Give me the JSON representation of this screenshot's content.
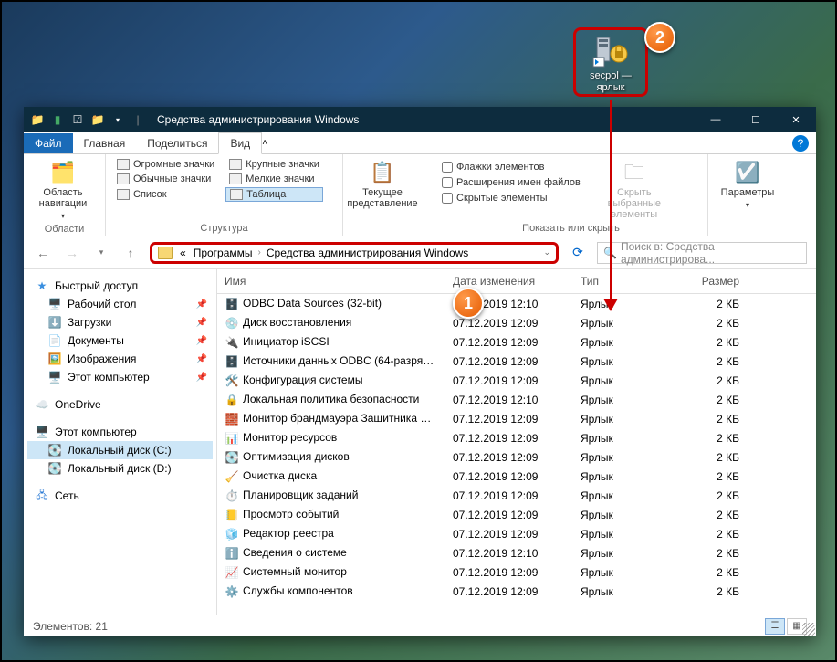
{
  "desktop": {
    "shortcut_label": "secpol — ярлык"
  },
  "callouts": {
    "one": "1",
    "two": "2"
  },
  "window": {
    "title": "Средства администрирования Windows",
    "tabs": {
      "file": "Файл",
      "home": "Главная",
      "share": "Поделиться",
      "view": "Вид"
    },
    "ribbon": {
      "nav_pane": "Область навигации",
      "group_areas": "Области",
      "layout": {
        "huge": "Огромные значки",
        "large": "Крупные значки",
        "normal": "Обычные значки",
        "small": "Мелкие значки",
        "list": "Список",
        "table": "Таблица"
      },
      "group_layout": "Структура",
      "current_view": "Текущее представление",
      "checks": {
        "checkboxes": "Флажки элементов",
        "ext": "Расширения имен файлов",
        "hidden": "Скрытые элементы"
      },
      "hide_selected": "Скрыть выбранные элементы",
      "group_showhide": "Показать или скрыть",
      "options": "Параметры"
    },
    "breadcrumb": {
      "prefix": "«",
      "p1": "Программы",
      "p2": "Средства администрирования Windows"
    },
    "search_placeholder": "Поиск в: Средства администрирова...",
    "columns": {
      "name": "Имя",
      "date": "Дата изменения",
      "type": "Тип",
      "size": "Размер"
    },
    "sidebar": {
      "quick": "Быстрый доступ",
      "desktop": "Рабочий стол",
      "downloads": "Загрузки",
      "documents": "Документы",
      "pictures": "Изображения",
      "thispc_q": "Этот компьютер",
      "onedrive": "OneDrive",
      "thispc": "Этот компьютер",
      "diskc": "Локальный диск (C:)",
      "diskd": "Локальный диск (D:)",
      "network": "Сеть"
    },
    "files": [
      {
        "name": "ODBC Data Sources (32-bit)",
        "date": "07.12.2019 12:10",
        "type": "Ярлык",
        "size": "2 КБ",
        "ico": "🗄️"
      },
      {
        "name": "Диск восстановления",
        "date": "07.12.2019 12:09",
        "type": "Ярлык",
        "size": "2 КБ",
        "ico": "💿"
      },
      {
        "name": "Инициатор iSCSI",
        "date": "07.12.2019 12:09",
        "type": "Ярлык",
        "size": "2 КБ",
        "ico": "🔌"
      },
      {
        "name": "Источники данных ODBC (64-разрядна...",
        "date": "07.12.2019 12:09",
        "type": "Ярлык",
        "size": "2 КБ",
        "ico": "🗄️"
      },
      {
        "name": "Конфигурация системы",
        "date": "07.12.2019 12:09",
        "type": "Ярлык",
        "size": "2 КБ",
        "ico": "🛠️"
      },
      {
        "name": "Локальная политика безопасности",
        "date": "07.12.2019 12:10",
        "type": "Ярлык",
        "size": "2 КБ",
        "ico": "🔒"
      },
      {
        "name": "Монитор брандмауэра Защитника Win...",
        "date": "07.12.2019 12:09",
        "type": "Ярлык",
        "size": "2 КБ",
        "ico": "🧱"
      },
      {
        "name": "Монитор ресурсов",
        "date": "07.12.2019 12:09",
        "type": "Ярлык",
        "size": "2 КБ",
        "ico": "📊"
      },
      {
        "name": "Оптимизация дисков",
        "date": "07.12.2019 12:09",
        "type": "Ярлык",
        "size": "2 КБ",
        "ico": "💽"
      },
      {
        "name": "Очистка диска",
        "date": "07.12.2019 12:09",
        "type": "Ярлык",
        "size": "2 КБ",
        "ico": "🧹"
      },
      {
        "name": "Планировщик заданий",
        "date": "07.12.2019 12:09",
        "type": "Ярлык",
        "size": "2 КБ",
        "ico": "⏱️"
      },
      {
        "name": "Просмотр событий",
        "date": "07.12.2019 12:09",
        "type": "Ярлык",
        "size": "2 КБ",
        "ico": "📒"
      },
      {
        "name": "Редактор реестра",
        "date": "07.12.2019 12:09",
        "type": "Ярлык",
        "size": "2 КБ",
        "ico": "🧊"
      },
      {
        "name": "Сведения о системе",
        "date": "07.12.2019 12:10",
        "type": "Ярлык",
        "size": "2 КБ",
        "ico": "ℹ️"
      },
      {
        "name": "Системный монитор",
        "date": "07.12.2019 12:09",
        "type": "Ярлык",
        "size": "2 КБ",
        "ico": "📈"
      },
      {
        "name": "Службы компонентов",
        "date": "07.12.2019 12:09",
        "type": "Ярлык",
        "size": "2 КБ",
        "ico": "⚙️"
      }
    ],
    "status": "Элементов: 21"
  }
}
